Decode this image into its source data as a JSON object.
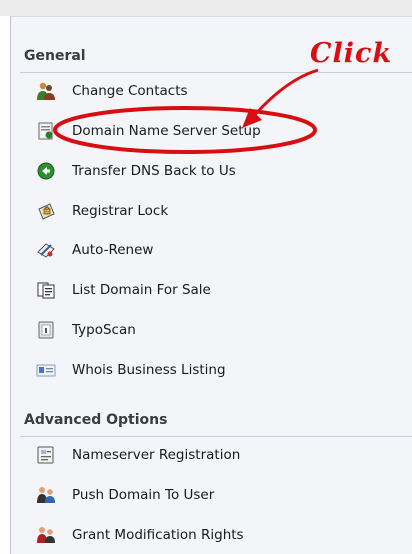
{
  "general": {
    "header": "General",
    "items": [
      {
        "label": "Change Contacts",
        "icon": "contacts-icon"
      },
      {
        "label": "Domain Name Server Setup",
        "icon": "dns-setup-icon"
      },
      {
        "label": "Transfer DNS Back to Us",
        "icon": "transfer-dns-icon"
      },
      {
        "label": "Registrar Lock",
        "icon": "lock-icon"
      },
      {
        "label": "Auto-Renew",
        "icon": "auto-renew-icon"
      },
      {
        "label": "List Domain For Sale",
        "icon": "list-for-sale-icon"
      },
      {
        "label": "TypoScan",
        "icon": "typoscan-icon"
      },
      {
        "label": "Whois Business Listing",
        "icon": "business-listing-icon"
      }
    ]
  },
  "advanced": {
    "header": "Advanced Options",
    "items": [
      {
        "label": "Nameserver Registration",
        "icon": "nameserver-registration-icon"
      },
      {
        "label": "Push Domain To User",
        "icon": "push-domain-icon"
      },
      {
        "label": "Grant Modification Rights",
        "icon": "grant-rights-icon"
      }
    ]
  },
  "annotation": {
    "text": "Click",
    "color": "#d90e12"
  }
}
